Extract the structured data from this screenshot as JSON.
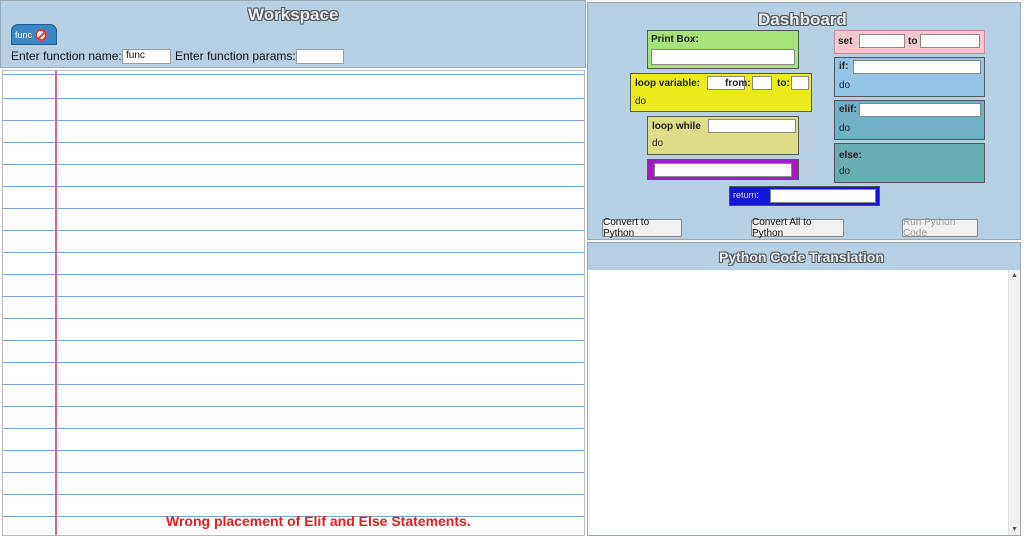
{
  "workspace": {
    "title": "Workspace",
    "tab_label": "func",
    "function_name_label": "Enter function name:",
    "function_name_value": "func",
    "function_params_label": "Enter function params:",
    "function_params_value": "",
    "status_message": "Wrong placement of Elif and Else Statements."
  },
  "dashboard": {
    "title": "Dashboard",
    "print_box_label": "Print Box:",
    "loop_variable_label": "loop variable:",
    "from_label": "from:",
    "to_label": "to:",
    "do_label": "do",
    "loop_while_label": "loop while",
    "set_label": "set",
    "set_to_label": "to",
    "if_label": "if:",
    "elif_label": "elif:",
    "else_label": "else:",
    "return_label": "return:",
    "convert_button": "Convert to Python",
    "convert_all_button": "Convert All to Python",
    "run_button": "Run Python Code"
  },
  "python": {
    "title": "Python Code Translation",
    "code": ""
  },
  "colors": {
    "panel_bg": "#b7cfe2",
    "print_box": "#a6e27a",
    "loop_variable": "#ecec1c",
    "loop_while": "#dede88",
    "purple_block": "#a21cc0",
    "return_block": "#1515d6",
    "set_block": "#f5c8d0",
    "if_block": "#93c4e5",
    "elif_block": "#6fb2c6",
    "else_block": "#67aeb3",
    "error_text": "#e02020"
  }
}
